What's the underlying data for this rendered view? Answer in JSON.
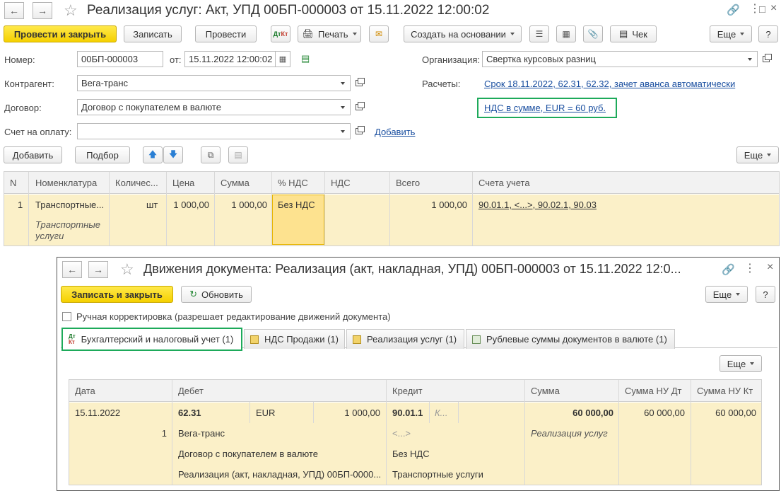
{
  "window": {
    "title": "Реализация услуг: Акт, УПД 00БП-000003 от 15.11.2022 12:00:02",
    "toolbar": {
      "post_close": "Провести и закрыть",
      "save": "Записать",
      "post": "Провести",
      "print": "Печать",
      "create_based": "Создать на основании",
      "check": "Чек",
      "more": "Еще",
      "help": "?"
    },
    "form": {
      "number_label": "Номер:",
      "number_value": "00БП-000003",
      "date_label": "от:",
      "date_value": "15.11.2022 12:00:02",
      "org_label": "Организация:",
      "org_value": "Свертка курсовых разниц",
      "contractor_label": "Контрагент:",
      "contractor_value": "Вега-транс",
      "settlements_label": "Расчеты:",
      "settlements_link": "Срок 18.11.2022, 62.31, 62.32, зачет аванса автоматически",
      "contract_label": "Договор:",
      "contract_value": "Договор с покупателем в валюте",
      "vat_link": "НДС в сумме, EUR = 60 руб.",
      "invoice_label": "Счет на оплату:",
      "invoice_value": "",
      "add_link": "Добавить"
    },
    "table_toolbar": {
      "add": "Добавить",
      "select": "Подбор",
      "more": "Еще"
    },
    "table": {
      "headers": [
        "N",
        "Номенклатура",
        "Количес...",
        "Цена",
        "Сумма",
        "% НДС",
        "НДС",
        "Всего",
        "Счета учета"
      ],
      "row": {
        "n": "1",
        "item": "Транспортные...",
        "item_sub": "Транспортные услуги",
        "unit": "шт",
        "price": "1 000,00",
        "sum": "1 000,00",
        "vat_rate": "Без НДС",
        "vat": "",
        "total": "1 000,00",
        "accounts": "90.01.1, <...>, 90.02.1, 90.03"
      }
    }
  },
  "movements": {
    "title": "Движения документа: Реализация (акт, накладная, УПД) 00БП-000003 от 15.11.2022 12:0...",
    "toolbar": {
      "save_close": "Записать и закрыть",
      "refresh": "Обновить",
      "more": "Еще",
      "help": "?"
    },
    "manual_checkbox": "Ручная корректировка (разрешает редактирование движений документа)",
    "tabs": [
      "Бухгалтерский и налоговый учет (1)",
      "НДС Продажи (1)",
      "Реализация услуг (1)",
      "Рублевые суммы документов в валюте (1)"
    ],
    "grid_more": "Еще",
    "grid": {
      "headers": [
        "Дата",
        "Дебет",
        "Кредит",
        "Сумма",
        "Сумма НУ Дт",
        "Сумма НУ Кт"
      ],
      "row": {
        "date": "15.11.2022",
        "debit_account": "62.31",
        "currency": "EUR",
        "currency_amount": "1 000,00",
        "credit_account": "90.01.1",
        "credit_k": "К...",
        "sum": "60 000,00",
        "sum_nu_dt": "60 000,00",
        "sum_nu_kt": "60 000,00",
        "line_no": "1",
        "debit_sub1": "Вега-транс",
        "credit_sub1": "<...>",
        "content": "Реализация услуг",
        "debit_sub2": "Договор с покупателем в валюте",
        "credit_sub2": "Без НДС",
        "debit_sub3": "Реализация (акт, накладная, УПД) 00БП-0000...",
        "credit_sub3": "Транспортные услуги"
      }
    }
  },
  "colors": {
    "accent_yellow": "#f5d000",
    "row_highlight": "#fbf0c8",
    "green_highlight": "#1daa5a",
    "link_blue": "#1a4fa0"
  }
}
